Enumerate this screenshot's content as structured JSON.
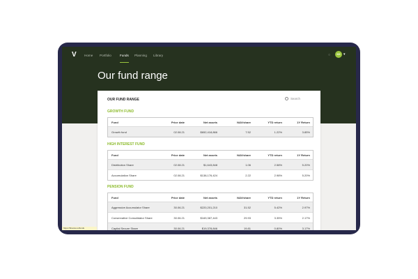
{
  "nav": {
    "logo": "V",
    "items": [
      {
        "label": "Home"
      },
      {
        "label": "Portfolio"
      },
      {
        "label": "Funds"
      },
      {
        "label": "Planning"
      },
      {
        "label": "Library"
      }
    ],
    "avatar_initials": "KH"
  },
  "page_title": "Our fund range",
  "card": {
    "title": "OUR FUND RANGE",
    "search_placeholder": "Search"
  },
  "columns": [
    "Fund",
    "Price date",
    "Net assets",
    "NAV/share",
    "YTD return",
    "1Y Return"
  ],
  "sections": [
    {
      "title": "GROWTH FUND",
      "rows": [
        [
          "Growth fund",
          "02.08.21",
          "$652,418,866",
          "7.52",
          "1.22%",
          "3.85%"
        ]
      ]
    },
    {
      "title": "HIGH INTEREST FUND",
      "rows": [
        [
          "Distribution Share",
          "02.08.21",
          "$1,643,848",
          "1.06",
          "2.58%",
          "5.20%"
        ],
        [
          "Accumulation Share",
          "02.08.21",
          "$138,176,424",
          "2.22",
          "2.98%",
          "5.20%"
        ]
      ]
    },
    {
      "title": "PENSION FUND",
      "rows": [
        [
          "Aggressive Accumulator Share",
          "30.06.21",
          "$220,201,210",
          "31.52",
          "5.42%",
          "2.97%"
        ],
        [
          "Conservative Consolidator Share",
          "30.06.21",
          "$169,387,443",
          "29.93",
          "3.35%",
          "2.17%"
        ],
        [
          "Capital Secure Share",
          "30.06.21",
          "$19,378,846",
          "19.81",
          "0.80%",
          "3.17%"
        ]
      ]
    }
  ],
  "status_url": "https://finance.io/funds",
  "colors": {
    "hero": "#26321f",
    "accent": "#9bc53d",
    "device_frame": "#27284a",
    "background": "#f1f0ee"
  }
}
